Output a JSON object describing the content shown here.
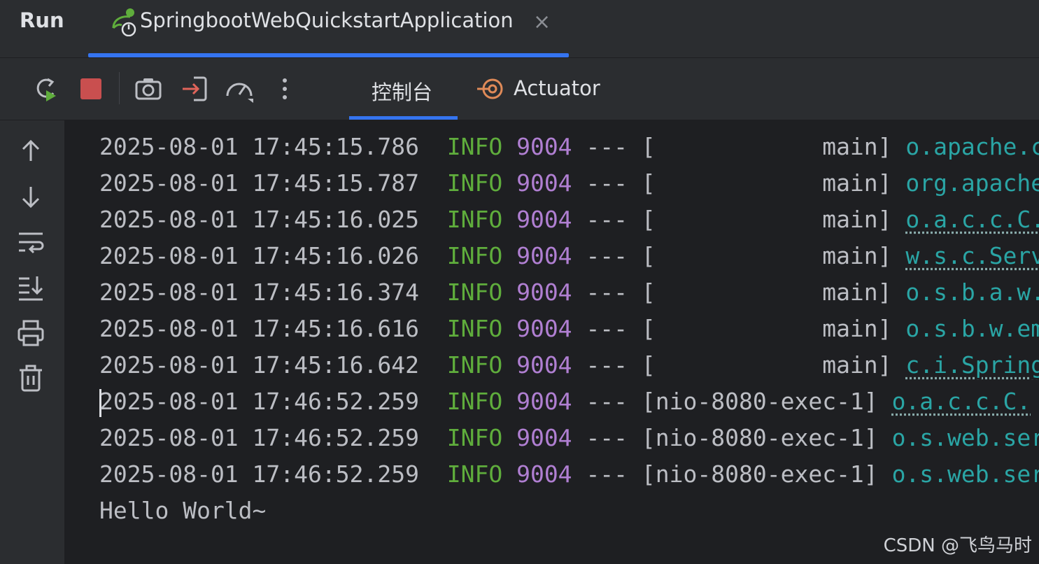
{
  "header": {
    "title": "Run",
    "tab_label": "SpringbootWebQuickstartApplication",
    "close_glyph": "×"
  },
  "toolbar": {
    "icons": [
      "rerun-icon",
      "stop-icon",
      "screenshot-icon",
      "login-icon",
      "performance-icon",
      "more-icon"
    ],
    "tabs": [
      {
        "label": "控制台",
        "active": true
      },
      {
        "label": "Actuator",
        "active": false
      }
    ]
  },
  "gutter": {
    "icons": [
      "arrow-up-icon",
      "arrow-down-icon",
      "soft-wrap-icon",
      "scroll-to-end-icon",
      "print-icon",
      "trash-icon"
    ]
  },
  "console": {
    "lines": [
      {
        "ts": "2025-08-01 17:45:15.786",
        "level": "INFO",
        "pid": "9004",
        "sep": "---",
        "thread": "[            main]",
        "logger": "o.apache.ca"
      },
      {
        "ts": "2025-08-01 17:45:15.787",
        "level": "INFO",
        "pid": "9004",
        "sep": "---",
        "thread": "[            main]",
        "logger": "org.apache"
      },
      {
        "ts": "2025-08-01 17:45:16.025",
        "level": "INFO",
        "pid": "9004",
        "sep": "---",
        "thread": "[            main]",
        "logger": "o.a.c.c.C."
      },
      {
        "ts": "2025-08-01 17:45:16.026",
        "level": "INFO",
        "pid": "9004",
        "sep": "---",
        "thread": "[            main]",
        "logger": "w.s.c.Servl"
      },
      {
        "ts": "2025-08-01 17:45:16.374",
        "level": "INFO",
        "pid": "9004",
        "sep": "---",
        "thread": "[            main]",
        "logger": "o.s.b.a.w.s"
      },
      {
        "ts": "2025-08-01 17:45:16.616",
        "level": "INFO",
        "pid": "9004",
        "sep": "---",
        "thread": "[            main]",
        "logger": "o.s.b.w.emb"
      },
      {
        "ts": "2025-08-01 17:45:16.642",
        "level": "INFO",
        "pid": "9004",
        "sep": "---",
        "thread": "[            main]",
        "logger": "c.i.Springb"
      },
      {
        "ts": "2025-08-01 17:46:52.259",
        "level": "INFO",
        "pid": "9004",
        "sep": "---",
        "thread": "[nio-8080-exec-1]",
        "logger": "o.a.c.c.C."
      },
      {
        "ts": "2025-08-01 17:46:52.259",
        "level": "INFO",
        "pid": "9004",
        "sep": "---",
        "thread": "[nio-8080-exec-1]",
        "logger": "o.s.web.ser"
      },
      {
        "ts": "2025-08-01 17:46:52.259",
        "level": "INFO",
        "pid": "9004",
        "sep": "---",
        "thread": "[nio-8080-exec-1]",
        "logger": "o.s.web.ser"
      }
    ],
    "output": "Hello World~"
  },
  "watermark": "CSDN @飞鸟马时",
  "colors": {
    "accent": "#3574f0",
    "info": "#5fad3c",
    "pid": "#b07fd2",
    "logger": "#2aa5a5",
    "stop": "#c94f4f"
  }
}
